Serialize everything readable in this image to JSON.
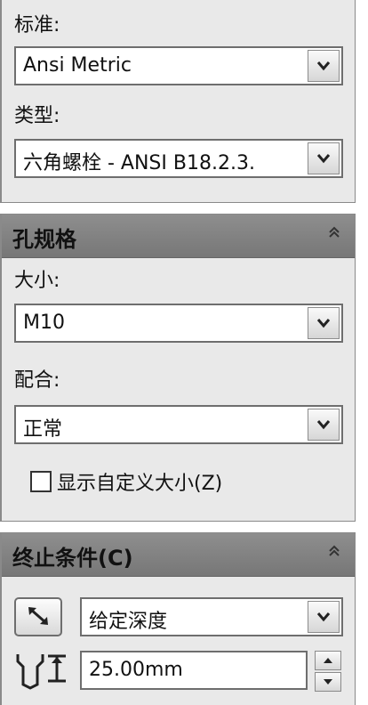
{
  "standard_section": {
    "standard_label": "标准:",
    "standard_value": "Ansi Metric",
    "type_label": "类型:",
    "type_value": "六角螺栓 - ANSI B18.2.3."
  },
  "hole_spec": {
    "title": "孔规格",
    "size_label": "大小:",
    "size_value": "M10",
    "fit_label": "配合:",
    "fit_value": "正常",
    "custom_size_label": "显示自定义大小(Z)",
    "custom_size_checked": false
  },
  "end_condition": {
    "title": "终止条件(C)",
    "mode_value": "给定深度",
    "depth_value": "25.00mm"
  },
  "icons": {
    "dropdown": "chevron-down-icon",
    "collapse": "double-chevron-up-icon",
    "reverse": "reverse-direction-icon",
    "depth": "blind-depth-icon",
    "spin": "spin-arrows-icon"
  }
}
